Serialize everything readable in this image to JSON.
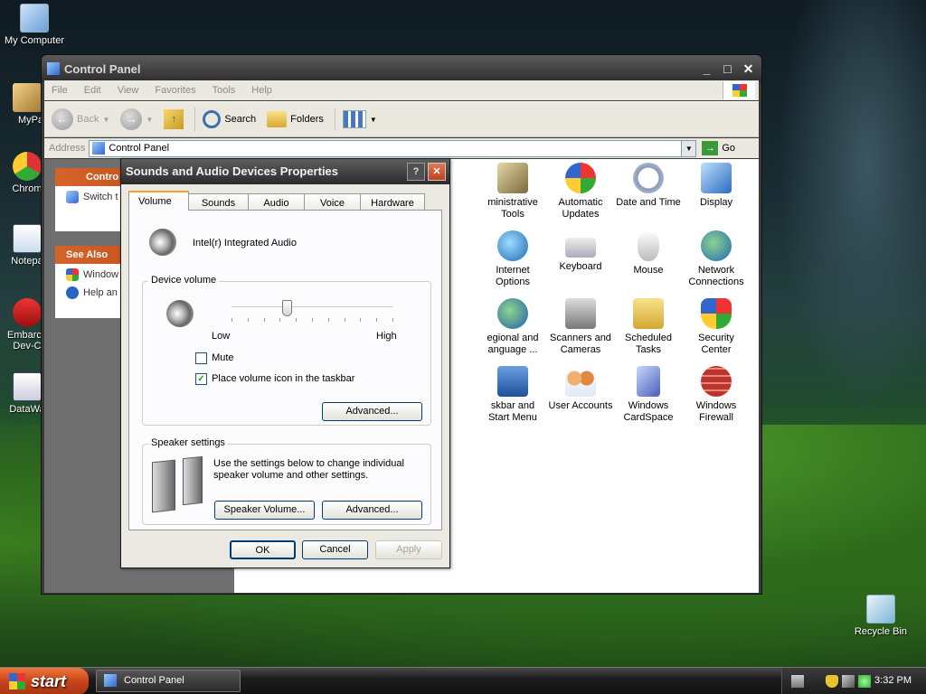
{
  "desktop": {
    "icons": [
      {
        "label": "My Computer",
        "icon": "my-computer-icon"
      },
      {
        "label": "MyPa",
        "icon": "shortcut-icon"
      },
      {
        "label": "Chrom",
        "icon": "chrome-icon"
      },
      {
        "label": "Notepa",
        "icon": "notepad-icon"
      },
      {
        "label": "Embarca\nDev-C",
        "icon": "embarcadero-icon"
      },
      {
        "label": "DataWa",
        "icon": "datawatch-icon"
      }
    ],
    "recycle_bin": "Recycle Bin"
  },
  "control_panel": {
    "title": "Control Panel",
    "menu": [
      "File",
      "Edit",
      "View",
      "Favorites",
      "Tools",
      "Help"
    ],
    "toolbar": {
      "back": "Back",
      "search": "Search",
      "folders": "Folders"
    },
    "address": {
      "label": "Address",
      "value": "Control Panel",
      "go": "Go"
    },
    "left_panel": {
      "control_box_title": "Contro",
      "switch_link": "Switch t",
      "see_also_title": "See Also",
      "see_also_items": [
        "Window",
        "Help an"
      ]
    },
    "items": [
      {
        "label": "Administrative Tools",
        "display": "ministrative\nTools",
        "icon": "admin-tools-icon"
      },
      {
        "label": "Automatic Updates",
        "display": "Automatic\nUpdates",
        "icon": "windows-update-icon"
      },
      {
        "label": "Date and Time",
        "display": "Date and Time",
        "icon": "clock-icon"
      },
      {
        "label": "Display",
        "display": "Display",
        "icon": "display-icon"
      },
      {
        "label": "Internet Options",
        "display": "Internet\nOptions",
        "icon": "internet-options-icon"
      },
      {
        "label": "Keyboard",
        "display": "Keyboard",
        "icon": "keyboard-icon"
      },
      {
        "label": "Mouse",
        "display": "Mouse",
        "icon": "mouse-icon"
      },
      {
        "label": "Network Connections",
        "display": "Network\nConnections",
        "icon": "network-icon"
      },
      {
        "label": "Regional and Language Options",
        "display": "egional and\nanguage ...",
        "icon": "globe-icon"
      },
      {
        "label": "Scanners and Cameras",
        "display": "Scanners and\nCameras",
        "icon": "scanner-icon"
      },
      {
        "label": "Scheduled Tasks",
        "display": "Scheduled\nTasks",
        "icon": "scheduled-tasks-icon"
      },
      {
        "label": "Security Center",
        "display": "Security\nCenter",
        "icon": "shield-icon"
      },
      {
        "label": "Taskbar and Start Menu",
        "display": "skbar and\nStart Menu",
        "icon": "taskbar-icon"
      },
      {
        "label": "User Accounts",
        "display": "User Accounts",
        "icon": "users-icon"
      },
      {
        "label": "Windows CardSpace",
        "display": "Windows\nCardSpace",
        "icon": "cardspace-icon"
      },
      {
        "label": "Windows Firewall",
        "display": "Windows\nFirewall",
        "icon": "firewall-icon"
      }
    ]
  },
  "dialog": {
    "title": "Sounds and Audio Devices Properties",
    "help_btn": "?",
    "close_btn": "✕",
    "tabs": [
      "Volume",
      "Sounds",
      "Audio",
      "Voice",
      "Hardware"
    ],
    "active_tab": "Volume",
    "device_name": "Intel(r) Integrated Audio",
    "device_volume": {
      "label": "Device volume",
      "low": "Low",
      "high": "High",
      "level": 0.35,
      "mute_label": "Mute",
      "mute_checked": false,
      "tray_label": "Place volume icon in the taskbar",
      "tray_checked": true,
      "advanced": "Advanced..."
    },
    "speaker_settings": {
      "label": "Speaker settings",
      "text": "Use the settings below to change individual speaker volume and other settings.",
      "speaker_volume_btn": "Speaker Volume...",
      "advanced": "Advanced..."
    },
    "buttons": {
      "ok": "OK",
      "cancel": "Cancel",
      "apply": "Apply"
    }
  },
  "taskbar": {
    "start": "start",
    "task": "Control Panel",
    "clock": "3:32 PM"
  }
}
